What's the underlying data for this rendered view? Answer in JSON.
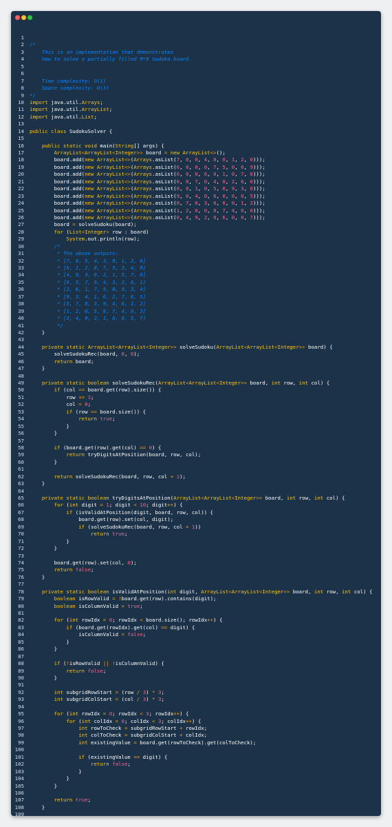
{
  "window": {
    "buttons": [
      "close",
      "minimize",
      "zoom"
    ]
  },
  "code": {
    "language": "java",
    "lines": [
      "",
      "/*",
      "    This is an implementation that demonstrates",
      "    how to solve a partially filled 9*9 Sudoku board.",
      "",
      "",
      "    Time complexity: O(1)",
      "    Space complexity: O(1)",
      "*/",
      "import java.util.Arrays;",
      "import java.util.ArrayList;",
      "import java.util.List;",
      "",
      "public class SudokuSolver {",
      "",
      "    public static void main(String[] args) {",
      "        ArrayList<ArrayList<Integer>> board = new ArrayList<>();",
      "        board.add(new ArrayList<>(Arrays.asList(7, 0, 0, 4, 0, 0, 1, 2, 0)));",
      "        board.add(new ArrayList<>(Arrays.asList(6, 0, 0, 0, 7, 5, 0, 0, 9)));",
      "        board.add(new ArrayList<>(Arrays.asList(0, 0, 0, 6, 0, 1, 0, 7, 8)));",
      "        board.add(new ArrayList<>(Arrays.asList(0, 0, 7, 0, 4, 0, 2, 6, 0)));",
      "        board.add(new ArrayList<>(Arrays.asList(0, 0, 1, 0, 5, 0, 9, 3, 0)));",
      "        board.add(new ArrayList<>(Arrays.asList(9, 0, 4, 0, 6, 0, 0, 0, 5)));",
      "        board.add(new ArrayList<>(Arrays.asList(0, 7, 0, 3, 0, 0, 0, 1, 2)));",
      "        board.add(new ArrayList<>(Arrays.asList(1, 2, 0, 0, 0, 7, 4, 0, 0)));",
      "        board.add(new ArrayList<>(Arrays.asList(0, 4, 9, 2, 0, 6, 0, 0, 7)));",
      "        board = solveSudoku(board);",
      "        for (List<Integer> row : board)",
      "            System.out.println(row);",
      "        /*",
      "         * The above outputs:",
      "         * [7, 8, 5, 4, 3, 9, 1, 2, 6]",
      "         * [6, 1, 2, 8, 7, 5, 3, 4, 9]",
      "         * [4, 9, 3, 6, 2, 1, 5, 7, 8]",
      "         * [8, 5, 7, 9, 4, 3, 2, 6, 1]",
      "         * [2, 6, 1, 7, 5, 8, 9, 3, 4]",
      "         * [9, 3, 4, 1, 6, 2, 7, 8, 5]",
      "         * [5, 7, 8, 3, 9, 4, 6, 1, 2]",
      "         * [1, 2, 6, 5, 8, 7, 4, 9, 3]",
      "         * [3, 4, 9, 2, 1, 6, 8, 5, 7]",
      "         */",
      "    }",
      "",
      "    private static ArrayList<ArrayList<Integer>> solveSudoku(ArrayList<ArrayList<Integer>> board) {",
      "        solveSudokuRec(board, 0, 0);",
      "        return board;",
      "    }",
      "",
      "    private static boolean solveSudokuRec(ArrayList<ArrayList<Integer>> board, int row, int col) {",
      "        if (col == board.get(row).size()) {",
      "            row += 1;",
      "            col = 0;",
      "            if (row == board.size()) {",
      "                return true;",
      "            }",
      "        }",
      "",
      "        if (board.get(row).get(col) == 0) {",
      "            return tryDigitsAtPosition(board, row, col);",
      "        }",
      "",
      "        return solveSudokuRec(board, row, col + 1);",
      "    }",
      "",
      "    private static boolean tryDigitsAtPosition(ArrayList<ArrayList<Integer>> board, int row, int col) {",
      "        for (int digit = 1; digit < 10; digit++) {",
      "            if (isValidAtPosition(digit, board, row, col)) {",
      "                board.get(row).set(col, digit);",
      "                if (solveSudokuRec(board, row, col + 1))",
      "                    return true;",
      "            }",
      "        }",
      "",
      "        board.get(row).set(col, 0);",
      "        return false;",
      "    }",
      "",
      "    private static boolean isValidAtPosition(int digit, ArrayList<ArrayList<Integer>> board, int row, int col) {",
      "        boolean isRowValid = !board.get(row).contains(digit);",
      "        boolean isColumnValid = true;",
      "",
      "        for (int rowIdx = 0; rowIdx < board.size(); rowIdx++) {",
      "            if (board.get(rowIdx).get(col) == digit) {",
      "                isColumnValid = false;",
      "            }",
      "        }",
      "",
      "        if (!isRowValid || !isColumnValid) {",
      "            return false;",
      "        }",
      "",
      "        int subgridRowStart = (row / 3) * 3;",
      "        int subgridColStart = (col / 3) * 3;",
      "",
      "        for (int rowIdx = 0; rowIdx < 3; rowIdx++) {",
      "            for (int colIdx = 0; colIdx < 3; colIdx++) {",
      "                int rowToCheck = subgridRowStart + rowIdx;",
      "                int colToCheck = subgridColStart + colIdx;",
      "                int existingValue = board.get(rowToCheck).get(colToCheck);",
      "",
      "                if (existingValue == digit) {",
      "                    return false;",
      "                }",
      "            }",
      "        }",
      "",
      "        return true;",
      "    }",
      "",
      "}"
    ]
  },
  "colors": {
    "background": "#1b3248",
    "page": "#eff0f2",
    "keyword": "#ffc600",
    "number": "#ff628c",
    "comment": "#0088ff",
    "operator": "#ff9d00",
    "text": "#ffffff"
  }
}
